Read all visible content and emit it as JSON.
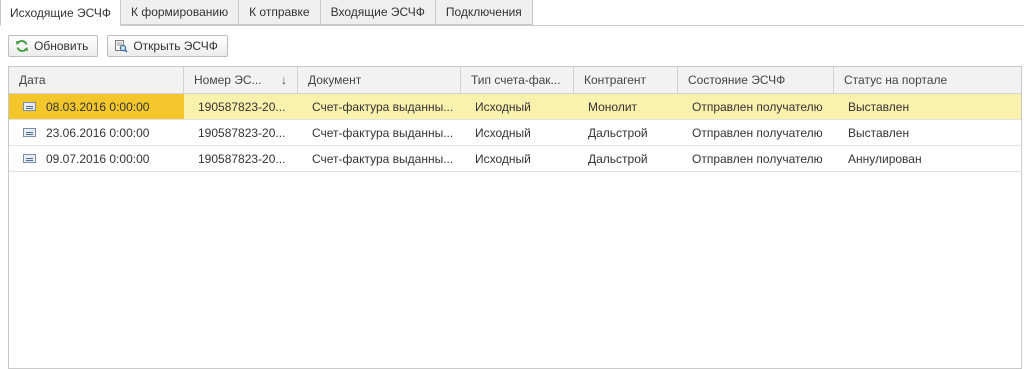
{
  "tabs": [
    {
      "label": "Исходящие ЭСЧФ",
      "active": true
    },
    {
      "label": "К формированию"
    },
    {
      "label": "К отправке"
    },
    {
      "label": "Входящие ЭСЧФ"
    },
    {
      "label": "Подключения"
    }
  ],
  "toolbar": {
    "refresh_label": "Обновить",
    "refresh_icon": "refresh-icon",
    "open_label": "Открыть ЭСЧФ",
    "open_icon": "open-document-icon"
  },
  "table": {
    "columns": [
      "Дата",
      "Номер ЭС...",
      "Документ",
      "Тип счета-фак...",
      "Контрагент",
      "Состояние ЭСЧФ",
      "Статус на портале"
    ],
    "sorted_column_indicator": "↓",
    "row_icon": "document-icon",
    "rows": [
      [
        "08.03.2016 0:00:00",
        "190587823-20...",
        "Счет-фактура выданны...",
        "Исходный",
        "Монолит",
        "Отправлен получателю",
        "Выставлен"
      ],
      [
        "23.06.2016 0:00:00",
        "190587823-20...",
        "Счет-фактура выданны...",
        "Исходный",
        "Дальстрой",
        "Отправлен получателю",
        "Выставлен"
      ],
      [
        "09.07.2016 0:00:00",
        "190587823-20...",
        "Счет-фактура выданны...",
        "Исходный",
        "Дальстрой",
        "Отправлен получателю",
        "Аннулирован"
      ]
    ],
    "selected_row": 0
  },
  "colors": {
    "selected_row": "#faf1ad",
    "selected_cell": "#f3c72b",
    "refresh_icon": "#3a9a3a"
  }
}
